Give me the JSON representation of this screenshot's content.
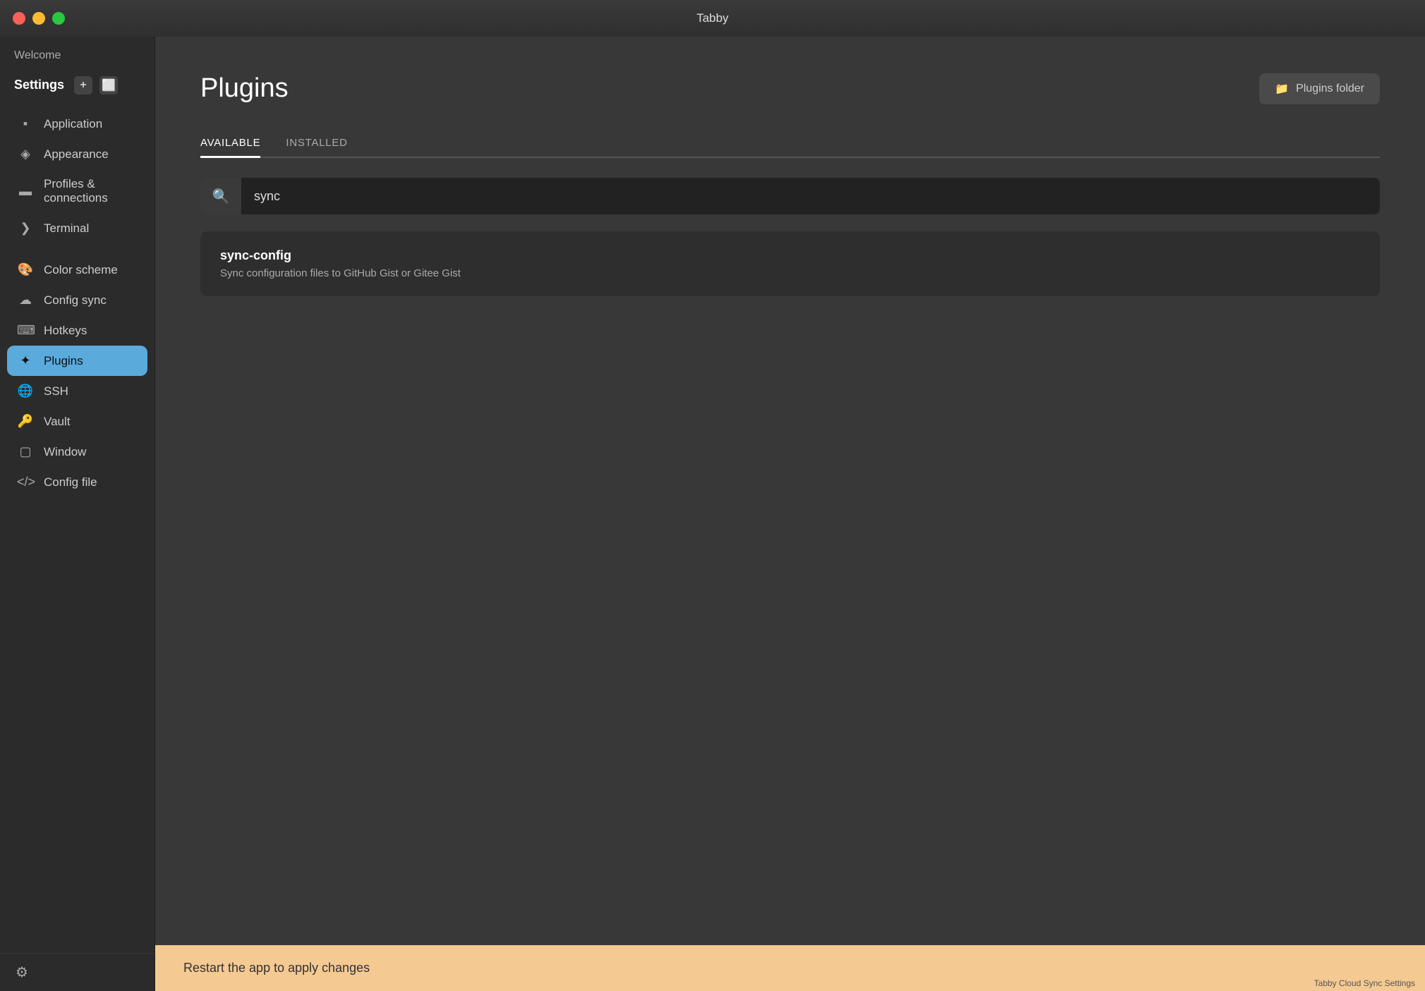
{
  "titlebar": {
    "title": "Tabby",
    "dots": [
      "red",
      "yellow",
      "green"
    ]
  },
  "sidebar": {
    "welcome_label": "Welcome",
    "settings_label": "Settings",
    "add_label": "+",
    "nav_items": [
      {
        "id": "application",
        "label": "Application",
        "icon": "🖥",
        "active": false
      },
      {
        "id": "appearance",
        "label": "Appearance",
        "icon": "🎨",
        "active": false
      },
      {
        "id": "profiles-connections",
        "label": "Profiles & connections",
        "icon": "🖨",
        "active": false
      },
      {
        "id": "terminal",
        "label": "Terminal",
        "icon": "❯",
        "active": false
      },
      {
        "id": "color-scheme",
        "label": "Color scheme",
        "icon": "🎨",
        "active": false
      },
      {
        "id": "config-sync",
        "label": "Config sync",
        "icon": "☁",
        "active": false
      },
      {
        "id": "hotkeys",
        "label": "Hotkeys",
        "icon": "⌨",
        "active": false
      },
      {
        "id": "plugins",
        "label": "Plugins",
        "icon": "✦",
        "active": true
      },
      {
        "id": "ssh",
        "label": "SSH",
        "icon": "🌐",
        "active": false
      },
      {
        "id": "vault",
        "label": "Vault",
        "icon": "🔑",
        "active": false
      },
      {
        "id": "window",
        "label": "Window",
        "icon": "🪟",
        "active": false
      },
      {
        "id": "config-file",
        "label": "Config file",
        "icon": "</>",
        "active": false
      }
    ],
    "gear_icon": "⚙"
  },
  "main": {
    "page_title": "Plugins",
    "plugins_folder_btn_label": "Plugins folder",
    "tabs": [
      {
        "id": "available",
        "label": "AVAILABLE",
        "active": true
      },
      {
        "id": "installed",
        "label": "INSTALLED",
        "active": false
      }
    ],
    "search": {
      "placeholder": "Search",
      "value": "sync",
      "icon": "🔍"
    },
    "plugin_results": [
      {
        "id": "sync-config",
        "name": "sync-config",
        "description": "Sync configuration files to GitHub Gist or Gitee Gist"
      }
    ]
  },
  "banner": {
    "text": "Restart the app to apply changes"
  },
  "status_bar": {
    "text": "Tabby Cloud Sync Settings"
  }
}
